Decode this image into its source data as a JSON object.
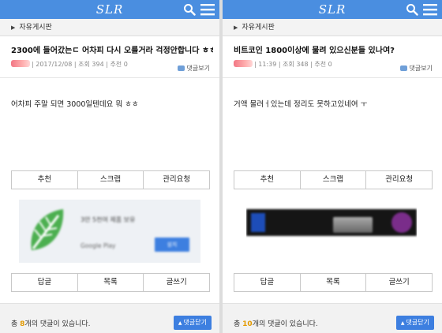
{
  "left": {
    "logo": "SLR",
    "breadcrumb": "자유게시판",
    "title": "2300에 들어갔는ㄷ 어차피 다시 오를거라 걱정안합니다 ㅎㅎ",
    "meta": "| 2017/12/08 | 조회 394 | 추천 0",
    "comment_view": "댓글보기",
    "body": "어차피 주말 되면 3000일텐데요 뭐 ㅎㅎ",
    "buttons1": [
      "추천",
      "스크랩",
      "관리요청"
    ],
    "ad": {
      "text": "3만 5천여 제품 보유",
      "store": "Google Play",
      "install": "설치"
    },
    "buttons2": [
      "답글",
      "목록",
      "글쓰기"
    ],
    "comments": {
      "prefix": "총 ",
      "count": "8",
      "suffix": "개의 댓글이 있습니다."
    },
    "close_label": "댓글닫기"
  },
  "right": {
    "logo": "SLR",
    "breadcrumb": "자유게시판",
    "title": "비트코인 1800이상에 물려 있으신분들 있나여?",
    "meta": "| 11:39 | 조회 348 | 추천 0",
    "comment_view": "댓글보기",
    "body": "거액 물려ㅓ있는데 정리도 못하고있네여 ㅜ",
    "buttons1": [
      "추천",
      "스크랩",
      "관리요청"
    ],
    "buttons2": [
      "답글",
      "목록",
      "글쓰기"
    ],
    "comments": {
      "prefix": "총 ",
      "count": "10",
      "suffix": "개의 댓글이 있습니다."
    },
    "close_label": "댓글닫기"
  },
  "colors": {
    "header": "#4a8ee0",
    "accent_button": "#3d7fe0",
    "count_highlight": "#e39a00"
  },
  "icons": [
    "search-icon",
    "hamburger-menu-icon",
    "chevron-right-icon",
    "comment-icon",
    "triangle-up-icon",
    "leaf-logo-icon"
  ]
}
